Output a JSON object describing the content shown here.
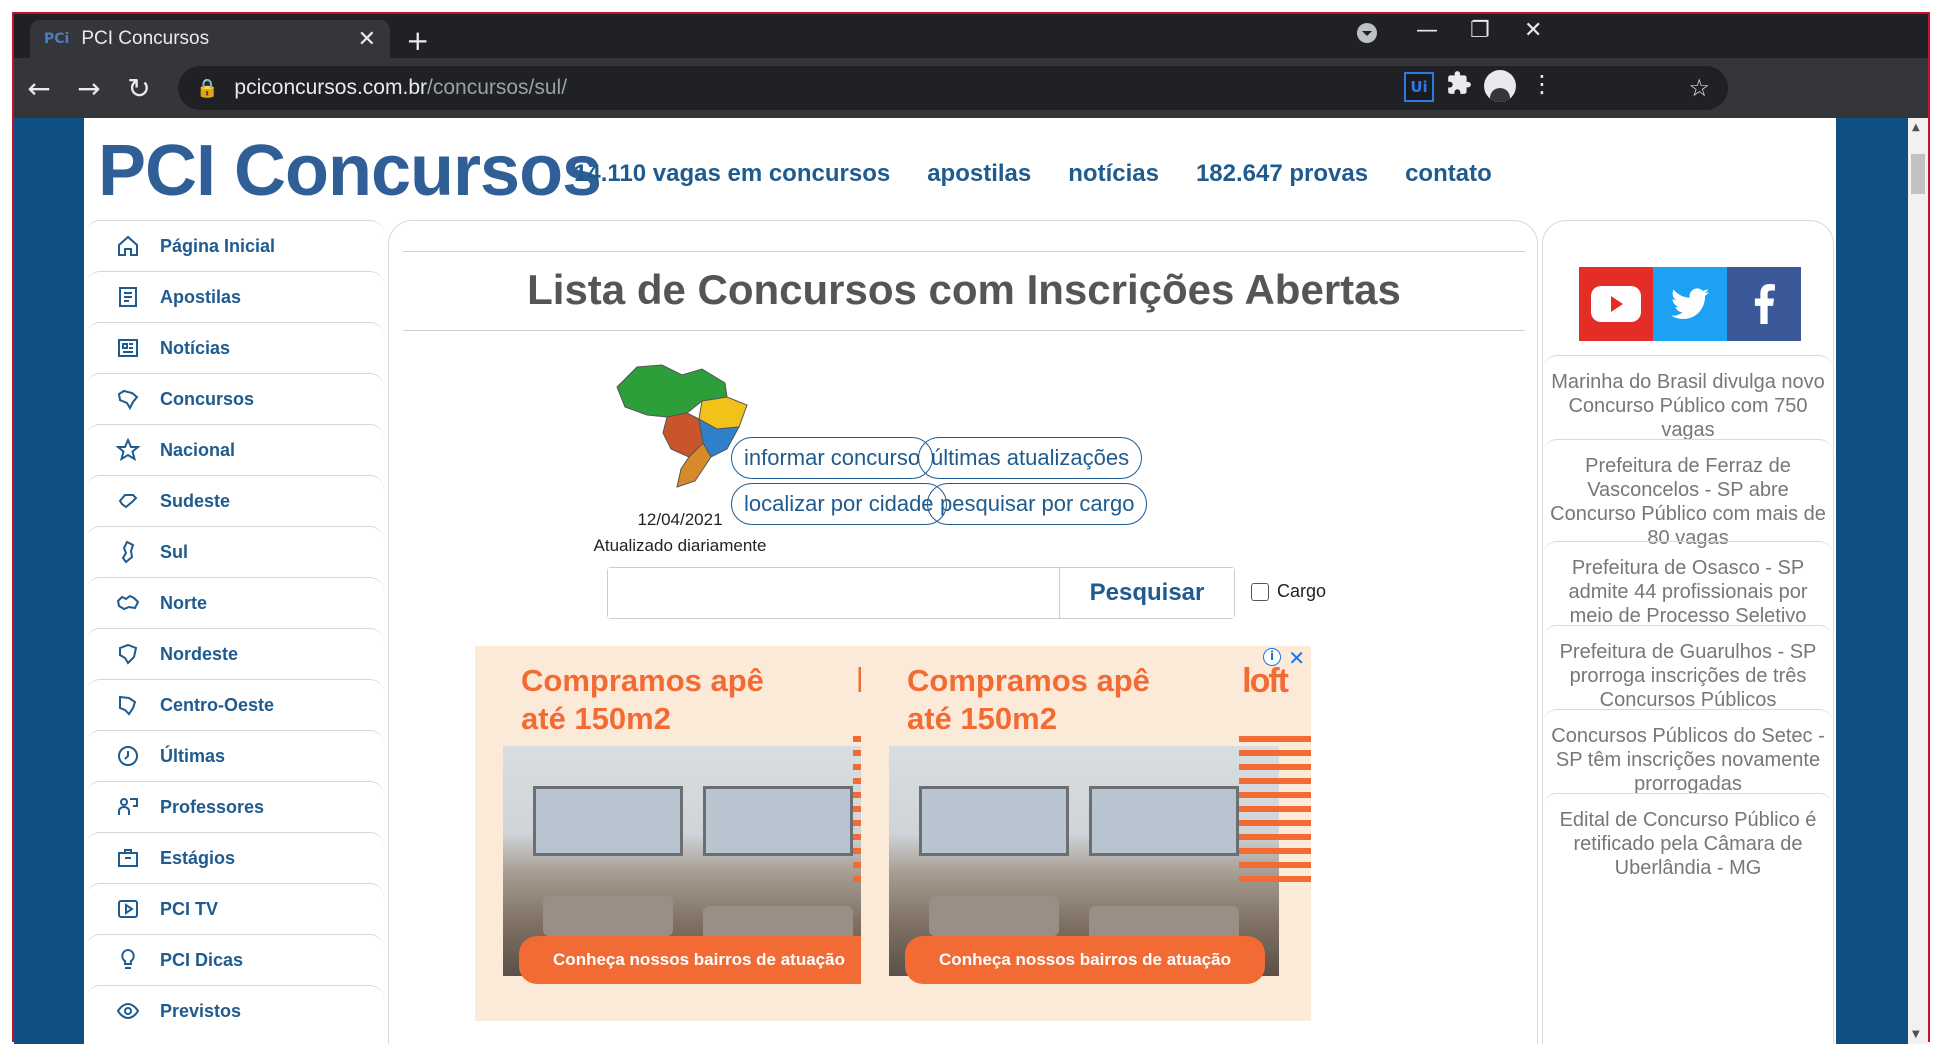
{
  "browser": {
    "tab_title": "PCI Concursos",
    "tab_favicon": "PCi",
    "url_host": "pciconcursos.com.br",
    "url_path": "/concursos/sul/"
  },
  "site": {
    "logo": "PCI Concursos",
    "nav": [
      "14.110 vagas em concursos",
      "apostilas",
      "notícias",
      "182.647 provas",
      "contato"
    ],
    "colors": {
      "brand": "#1f5b8f",
      "background": "#0f4f84",
      "ad_accent": "#f36b34"
    }
  },
  "sidebar": {
    "items": [
      {
        "label": "Página Inicial",
        "icon": "home-icon"
      },
      {
        "label": "Apostilas",
        "icon": "book-icon"
      },
      {
        "label": "Notícias",
        "icon": "news-icon"
      },
      {
        "label": "Concursos",
        "icon": "map-outline-icon"
      },
      {
        "label": "Nacional",
        "icon": "star-icon"
      },
      {
        "label": "Sudeste",
        "icon": "region-icon"
      },
      {
        "label": "Sul",
        "icon": "region-icon"
      },
      {
        "label": "Norte",
        "icon": "region-icon"
      },
      {
        "label": "Nordeste",
        "icon": "region-icon"
      },
      {
        "label": "Centro-Oeste",
        "icon": "region-icon"
      },
      {
        "label": "Últimas",
        "icon": "clock-icon"
      },
      {
        "label": "Professores",
        "icon": "teacher-icon"
      },
      {
        "label": "Estágios",
        "icon": "briefcase-icon"
      },
      {
        "label": "PCI TV",
        "icon": "play-icon"
      },
      {
        "label": "PCI Dicas",
        "icon": "lightbulb-icon"
      },
      {
        "label": "Previstos",
        "icon": "eye-icon"
      }
    ]
  },
  "main": {
    "title": "Lista de Concursos com Inscrições Abertas",
    "date": "12/04/2021",
    "updated": "Atualizado diariamente",
    "buttons": {
      "informar": "informar concurso",
      "ultimas": "últimas atualizações",
      "cidade": "localizar por cidade",
      "cargo": "pesquisar por cargo"
    },
    "search": {
      "placeholder": "",
      "button": "Pesquisar",
      "checkbox_label": "Cargo"
    }
  },
  "ads": [
    {
      "headline_1": "Compramos apê",
      "headline_2": "até 150m2",
      "brand": "loft",
      "cta": "Conheça nossos bairros de atuação"
    },
    {
      "headline_1": "Compramos apê",
      "headline_2": "até 150m2",
      "brand": "loft",
      "cta": "Conheça nossos bairros de atuação"
    }
  ],
  "right": {
    "social": [
      "youtube-icon",
      "twitter-icon",
      "facebook-icon"
    ],
    "news": [
      "Marinha do Brasil divulga novo Concurso Público com 750 vagas",
      "Prefeitura de Ferraz de Vasconcelos - SP abre Concurso Público com mais de 80 vagas",
      "Prefeitura de Osasco - SP admite 44 profissionais por meio de Processo Seletivo",
      "Prefeitura de Guarulhos - SP prorroga inscrições de três Concursos Públicos",
      "Concursos Públicos do Setec - SP têm inscrições novamente prorrogadas",
      "Edital de Concurso Público é retificado pela Câmara de Uberlândia - MG"
    ]
  }
}
